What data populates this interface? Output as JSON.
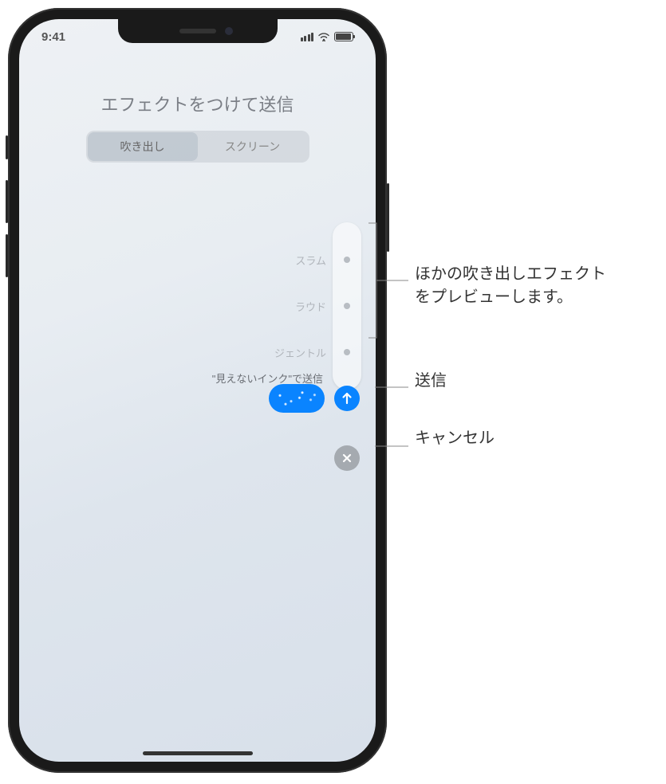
{
  "status": {
    "time": "9:41"
  },
  "header": {
    "title": "エフェクトをつけて送信"
  },
  "segments": {
    "bubble": "吹き出し",
    "screen": "スクリーン"
  },
  "effects": {
    "slam": "スラム",
    "loud": "ラウド",
    "gentle": "ジェントル",
    "invisible_ink_send": "\"見えないインク\"で送信"
  },
  "annotations": {
    "preview_line1": "ほかの吹き出しエフェクト",
    "preview_line2": "をプレビューします。",
    "send": "送信",
    "cancel": "キャンセル"
  }
}
